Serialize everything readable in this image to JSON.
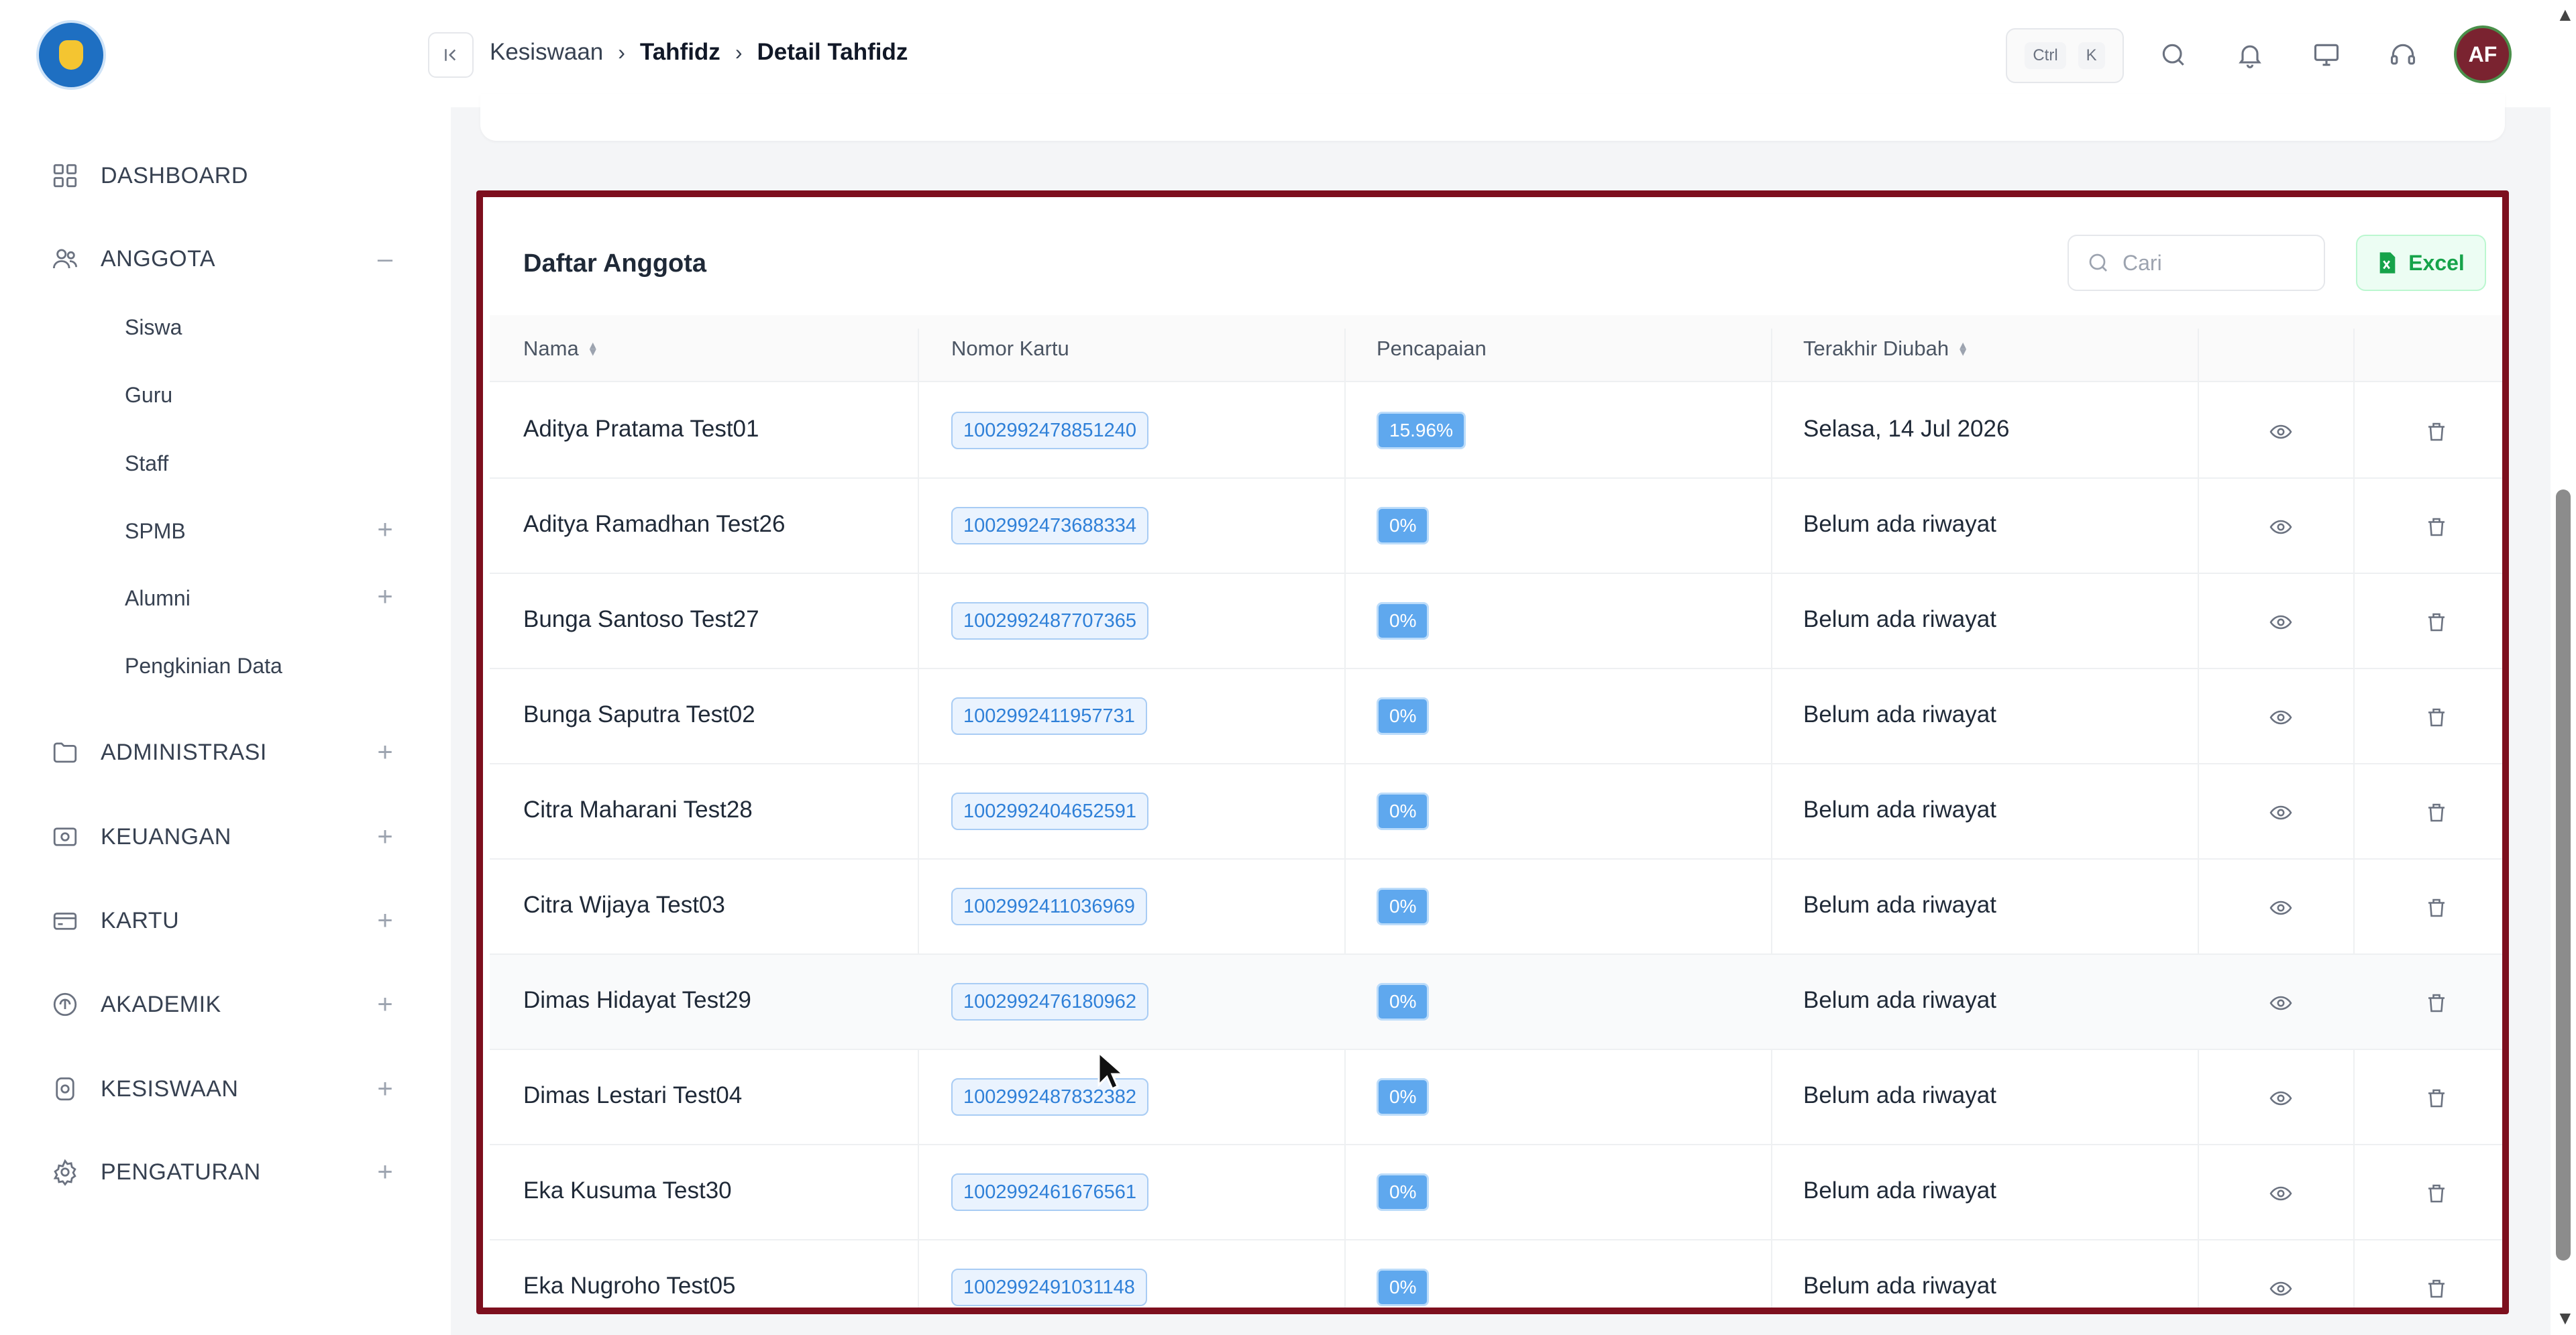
{
  "sidebar": {
    "items": [
      {
        "label": "DASHBOARD",
        "icon": "grid-icon",
        "toggle": ""
      },
      {
        "label": "ANGGOTA",
        "icon": "users-icon",
        "toggle": "–"
      },
      {
        "label": "ADMINISTRASI",
        "icon": "folder-icon",
        "toggle": "+"
      },
      {
        "label": "KEUANGAN",
        "icon": "wallet-icon",
        "toggle": "+"
      },
      {
        "label": "KARTU",
        "icon": "card-icon",
        "toggle": "+"
      },
      {
        "label": "AKADEMIK",
        "icon": "academic-icon",
        "toggle": "+"
      },
      {
        "label": "KESISWAAN",
        "icon": "student-icon",
        "toggle": "+"
      },
      {
        "label": "PENGATURAN",
        "icon": "gear-icon",
        "toggle": "+"
      }
    ],
    "sub_items": [
      {
        "label": "Siswa",
        "toggle": ""
      },
      {
        "label": "Guru",
        "toggle": ""
      },
      {
        "label": "Staff",
        "toggle": ""
      },
      {
        "label": "SPMB",
        "toggle": "+"
      },
      {
        "label": "Alumni",
        "toggle": "+"
      },
      {
        "label": "Pengkinian Data",
        "toggle": ""
      }
    ]
  },
  "header": {
    "breadcrumb": [
      "Kesiswaan",
      "Tahfidz",
      "Detail Tahfidz"
    ],
    "shortcut": [
      "Ctrl",
      "K"
    ],
    "avatar_initials": "AF"
  },
  "card": {
    "title": "Daftar Anggota",
    "search_placeholder": "Cari",
    "excel_label": "Excel",
    "columns": [
      "Nama",
      "Nomor Kartu",
      "Pencapaian",
      "Terakhir Diubah"
    ],
    "rows": [
      {
        "name": "Aditya Pratama Test01",
        "card": "1002992478851240",
        "pct": "15.96%",
        "updated": "Selasa, 14 Jul 2026"
      },
      {
        "name": "Aditya Ramadhan Test26",
        "card": "1002992473688334",
        "pct": "0%",
        "updated": "Belum ada riwayat"
      },
      {
        "name": "Bunga Santoso Test27",
        "card": "1002992487707365",
        "pct": "0%",
        "updated": "Belum ada riwayat"
      },
      {
        "name": "Bunga Saputra Test02",
        "card": "1002992411957731",
        "pct": "0%",
        "updated": "Belum ada riwayat"
      },
      {
        "name": "Citra Maharani Test28",
        "card": "1002992404652591",
        "pct": "0%",
        "updated": "Belum ada riwayat"
      },
      {
        "name": "Citra Wijaya Test03",
        "card": "1002992411036969",
        "pct": "0%",
        "updated": "Belum ada riwayat"
      },
      {
        "name": "Dimas Hidayat Test29",
        "card": "1002992476180962",
        "pct": "0%",
        "updated": "Belum ada riwayat"
      },
      {
        "name": "Dimas Lestari Test04",
        "card": "1002992487832382",
        "pct": "0%",
        "updated": "Belum ada riwayat"
      },
      {
        "name": "Eka Kusuma Test30",
        "card": "1002992461676561",
        "pct": "0%",
        "updated": "Belum ada riwayat"
      },
      {
        "name": "Eka Nugroho Test05",
        "card": "1002992491031148",
        "pct": "0%",
        "updated": "Belum ada riwayat"
      }
    ]
  },
  "colors": {
    "highlight_border": "#7d0f1e",
    "badge_blue": "#2f80d8",
    "excel_green": "#16a34a"
  }
}
